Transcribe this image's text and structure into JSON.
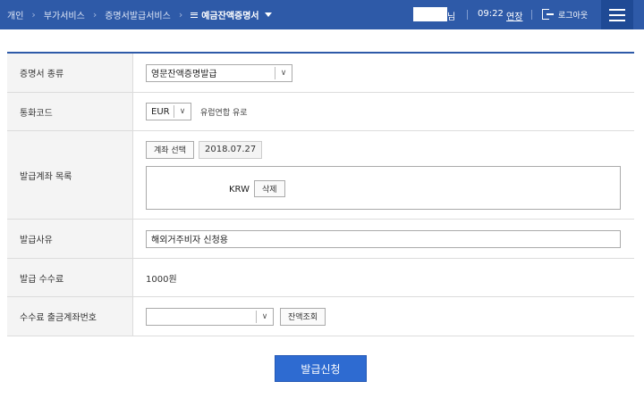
{
  "breadcrumb": {
    "items": [
      "개인",
      "부가서비스",
      "증명서발급서비스"
    ],
    "current": "예금잔액증명서"
  },
  "header": {
    "user_suffix": "님",
    "time": "09:22",
    "extend_label": "연장",
    "logout_label": "로그아웃"
  },
  "form": {
    "cert_type": {
      "label": "증명서 종류",
      "value": "영문잔액증명발급"
    },
    "currency": {
      "label": "통화코드",
      "value": "EUR",
      "description": "유럽연합 유로"
    },
    "accounts": {
      "label": "발급계좌 목록",
      "select_button": "계좌 선택",
      "date": "2018.07.27",
      "currency": "KRW",
      "delete_button": "삭제"
    },
    "reason": {
      "label": "발급사유",
      "value": "해외거주비자 신청용"
    },
    "fee": {
      "label": "발급 수수료",
      "value": "1000원"
    },
    "fee_account": {
      "label": "수수료 출금계좌번호",
      "value": "",
      "balance_button": "잔액조회"
    }
  },
  "submit_label": "발급신청",
  "colors": {
    "header_bg": "#2e5aa8",
    "accent": "#2e6bd1"
  }
}
